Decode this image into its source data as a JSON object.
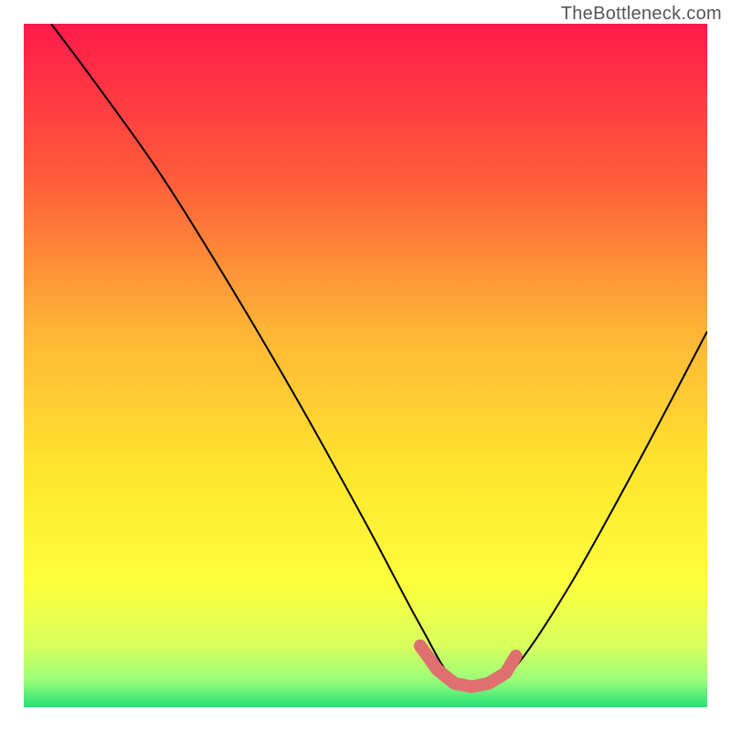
{
  "watermark": "TheBottleneck.com",
  "chart_data": {
    "type": "line",
    "title": "",
    "xlabel": "",
    "ylabel": "",
    "xlim": [
      0,
      100
    ],
    "ylim": [
      0,
      100
    ],
    "grid": false,
    "legend": false,
    "background_gradient": {
      "stops": [
        {
          "offset": 0.0,
          "color": "#ff1a4b"
        },
        {
          "offset": 0.22,
          "color": "#ff5a3a"
        },
        {
          "offset": 0.45,
          "color": "#ffb536"
        },
        {
          "offset": 0.66,
          "color": "#ffe62e"
        },
        {
          "offset": 0.82,
          "color": "#fdff3a"
        },
        {
          "offset": 0.91,
          "color": "#d8ff5e"
        },
        {
          "offset": 0.96,
          "color": "#9cff78"
        },
        {
          "offset": 1.0,
          "color": "#24e07a"
        }
      ]
    },
    "series": [
      {
        "name": "bottleneck-curve",
        "color": "#000000",
        "x": [
          4.0,
          10.0,
          20.0,
          30.0,
          40.0,
          50.0,
          58.0,
          63.0,
          68.0,
          72.0,
          80.0,
          90.0,
          100.0
        ],
        "values": [
          100.0,
          92.0,
          78.0,
          62.0,
          45.0,
          27.0,
          12.0,
          4.0,
          4.0,
          6.0,
          18.0,
          36.0,
          55.0
        ]
      },
      {
        "name": "optimal-zone-markers",
        "color": "#e07070",
        "marker_style": "round-bar",
        "x": [
          58.0,
          60.5,
          63.0,
          65.5,
          68.0,
          70.5,
          72.0
        ],
        "values": [
          9.0,
          5.5,
          3.5,
          3.0,
          3.5,
          5.0,
          7.5
        ]
      }
    ],
    "annotations": []
  }
}
